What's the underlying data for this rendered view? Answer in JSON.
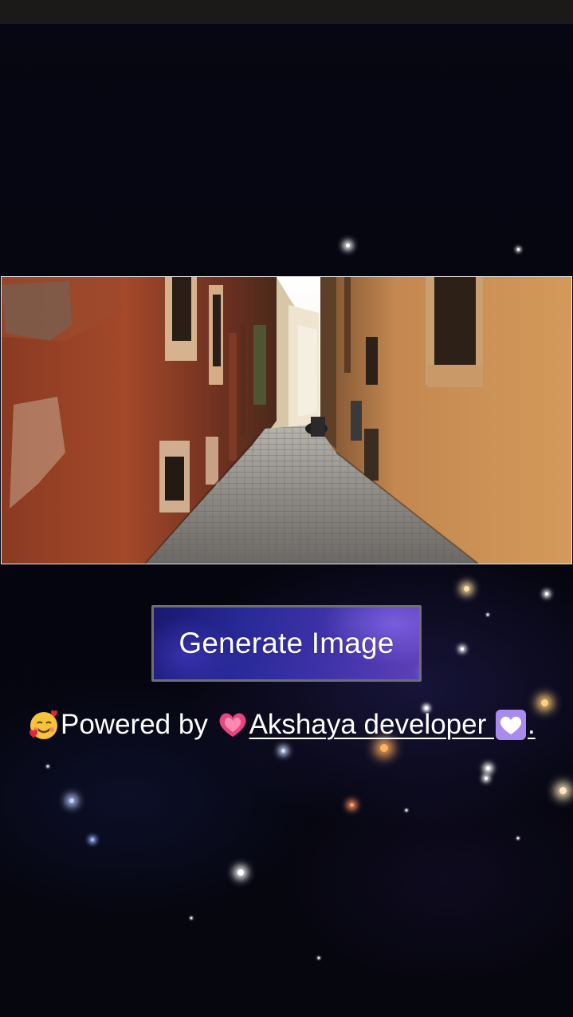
{
  "status_bar": {
    "background": "#1c1a19"
  },
  "photo": {
    "description_icon": "street-alley-photo"
  },
  "generate_button": {
    "label": "Generate Image"
  },
  "footer": {
    "prefix_emoji": "smiling-face-with-hearts-icon",
    "powered_text": "Powered by ",
    "heart_emoji": "growing-heart-icon",
    "developer_name": "Akshaya developer ",
    "suffix_emoji": "white-heart-icon",
    "suffix_punct": "."
  },
  "colors": {
    "background": "#05050f",
    "button_gradient_start": "#1a1870",
    "button_gradient_end": "#5d40b8",
    "text": "#ffffff",
    "frame_border": "#e9e9e9"
  }
}
